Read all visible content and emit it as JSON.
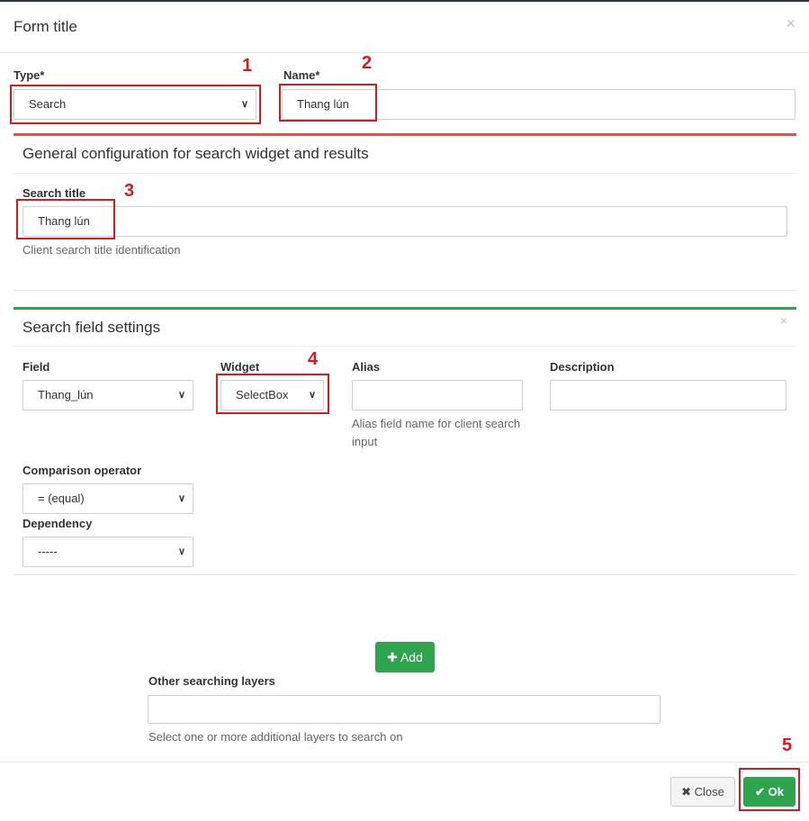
{
  "modal": {
    "title": "Form title",
    "close_icon": "×"
  },
  "type_field": {
    "label": "Type*",
    "value": "Search"
  },
  "name_field": {
    "label": "Name*",
    "value": "Thang lún"
  },
  "general_panel": {
    "title": "General configuration for search widget and results",
    "search_title_label": "Search title",
    "search_title_value": "Thang lún",
    "search_title_help": "Client search title identification"
  },
  "search_field_panel": {
    "title": "Search field settings",
    "close_icon": "×",
    "field_label": "Field",
    "field_value": "Thang_lún",
    "widget_label": "Widget",
    "widget_value": "SelectBox",
    "alias_label": "Alias",
    "alias_value": "",
    "alias_help": "Alias field name for client search input",
    "description_label": "Description",
    "description_value": "",
    "comparison_label": "Comparison operator",
    "comparison_value": "= (equal)",
    "dependency_label": "Dependency",
    "dependency_value": "-----"
  },
  "add_button": {
    "icon": "✚",
    "label": "Add"
  },
  "other_layers": {
    "label": "Other searching layers",
    "value": "",
    "help": "Select one or more additional layers to search on"
  },
  "footer": {
    "close_icon": "✖",
    "close_label": "Close",
    "ok_icon": "✔",
    "ok_label": "Ok"
  },
  "annotations": [
    "1",
    "2",
    "3",
    "4",
    "5"
  ],
  "colors": {
    "annotation_red": "#d71920",
    "panel_red": "#d9534f",
    "panel_green": "#2ea44f",
    "button_green": "#2ea44f"
  }
}
